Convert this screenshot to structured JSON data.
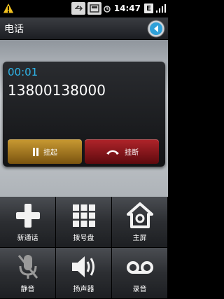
{
  "status_bar": {
    "time": "14:47",
    "network_badge": "E",
    "icons": [
      "usb-icon",
      "sd-card-icon",
      "wifi-icon",
      "alarm-icon",
      "signal-icon"
    ]
  },
  "title_bar": {
    "title": "电话"
  },
  "call": {
    "duration": "00:01",
    "number": "13800138000",
    "hold_label": "挂起",
    "end_label": "挂断"
  },
  "actions": [
    {
      "label": "新通话",
      "icon": "plus-icon"
    },
    {
      "label": "拨号盘",
      "icon": "dialpad-icon"
    },
    {
      "label": "主屏",
      "icon": "home-icon"
    },
    {
      "label": "静音",
      "icon": "mute-mic-icon"
    },
    {
      "label": "扬声器",
      "icon": "speaker-icon"
    },
    {
      "label": "录音",
      "icon": "voicemail-icon"
    }
  ],
  "colors": {
    "accent_blue": "#2fb4e8",
    "hold_button": "#c99a32",
    "end_button": "#b0242a"
  }
}
